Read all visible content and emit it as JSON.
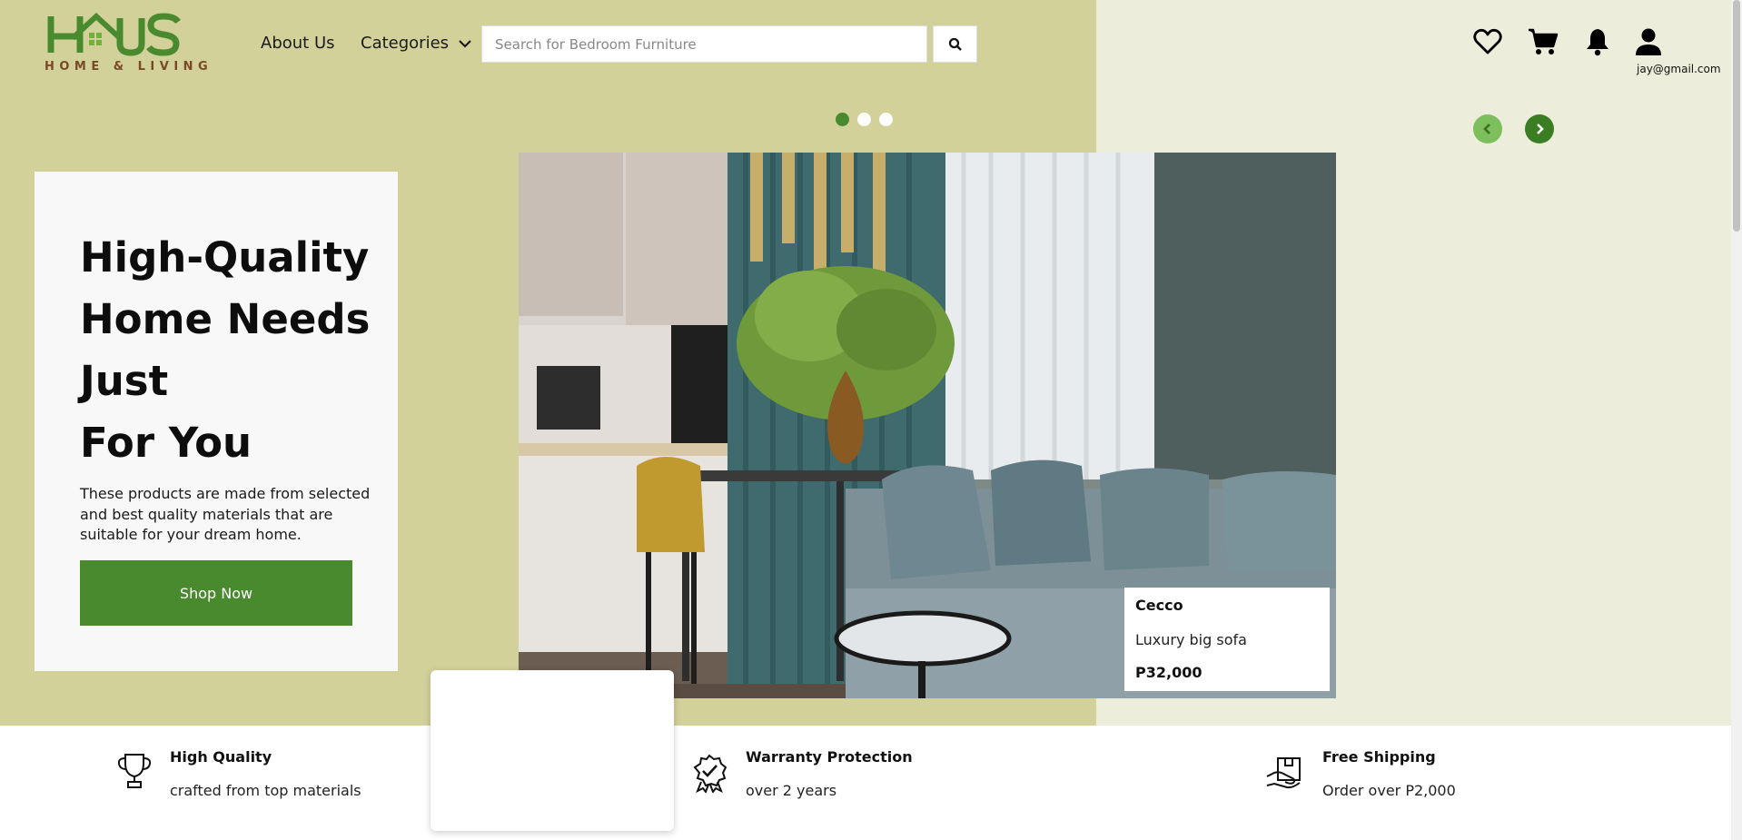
{
  "brand": {
    "logo_text": "HAUS",
    "tagline": "HOME & LIVING",
    "green": "#4a8a2e",
    "brown": "#7a4a28"
  },
  "nav": {
    "about": "About Us",
    "categories": "Categories"
  },
  "search": {
    "placeholder": "Search for Bedroom Furniture",
    "value": ""
  },
  "header_icons": [
    "heart-icon",
    "cart-icon",
    "bell-icon",
    "user-icon"
  ],
  "user": {
    "email": "jay@gmail.com"
  },
  "carousel": {
    "slide_count": 3,
    "active_index": 0
  },
  "hero": {
    "title_lines": [
      "High-Quality",
      "Home Needs",
      "Just",
      "For You"
    ],
    "description": "These products are made from selected and best quality materials that are suitable for your dream home.",
    "cta": "Shop Now"
  },
  "product": {
    "name": "Cecco",
    "description": "Luxury big sofa",
    "price": "P32,000"
  },
  "features": [
    {
      "icon": "trophy-icon",
      "title": "High Quality",
      "subtitle": "crafted from top materials"
    },
    {
      "icon": "warranty-badge-icon",
      "title": "Warranty Protection",
      "subtitle": "over 2 years"
    },
    {
      "icon": "shipping-box-icon",
      "title": "Free Shipping",
      "subtitle": "Order over P2,000"
    }
  ]
}
